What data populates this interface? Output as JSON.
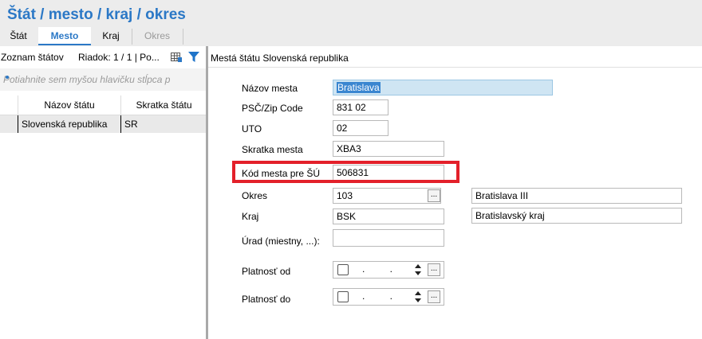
{
  "header": {
    "title": "Štát / mesto / kraj / okres",
    "tabs": [
      {
        "label": "Štát"
      },
      {
        "label": "Mesto"
      },
      {
        "label": "Kraj"
      },
      {
        "label": "Okres"
      }
    ]
  },
  "left": {
    "toolbar_label": "Zoznam štátov",
    "row_indicator": "Riadok: 1 / 1 | Po...",
    "group_hint": "Potiahnite sem myšou hlavičku stĺpca p",
    "columns": [
      "Názov štátu",
      "Skratka štátu"
    ],
    "rows": [
      {
        "name": "Slovenská republika",
        "code": "SR"
      }
    ]
  },
  "right": {
    "title": "Mestá štátu Slovenská republika",
    "fields": {
      "nazov_label": "Názov mesta",
      "nazov_value": "Bratislava",
      "psc_label": "PSČ/Zip Code",
      "psc_value": "831 02",
      "uto_label": "UTO",
      "uto_value": "02",
      "skratka_label": "Skratka mesta",
      "skratka_value": "XBA3",
      "kod_label": "Kód mesta pre ŠÚ",
      "kod_value": "506831",
      "okres_label": "Okres",
      "okres_value": "103",
      "okres_name": "Bratislava III",
      "kraj_label": "Kraj",
      "kraj_value": "BSK",
      "kraj_name": "Bratislavský kraj",
      "urad_label": "Úrad (miestny, ...):",
      "urad_value": "",
      "platnost_od_label": "Platnosť od",
      "platnost_do_label": "Platnosť do",
      "date_placeholder": ". ."
    },
    "browse_button": "..."
  },
  "colors": {
    "accent": "#2b78c6",
    "highlight": "#e3202a",
    "selection": "#3a86d0"
  }
}
